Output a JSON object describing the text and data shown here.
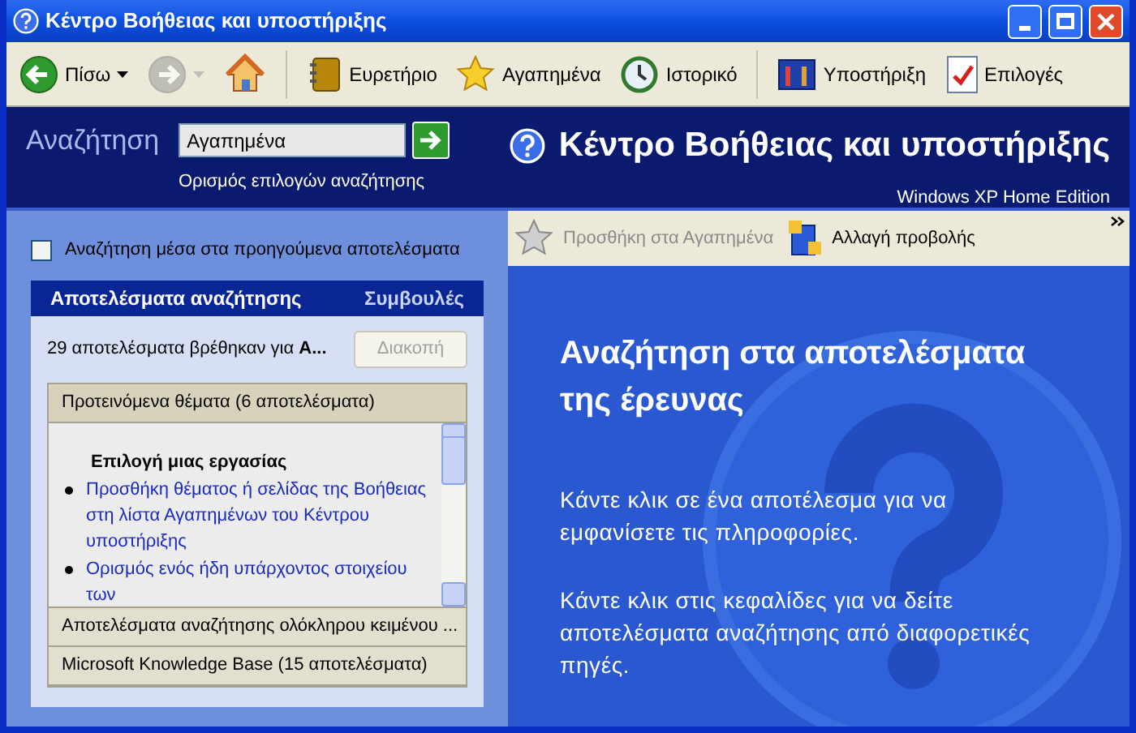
{
  "window": {
    "title": "Κέντρο Βοήθειας και υποστήριξης"
  },
  "toolbar": [
    {
      "kind": "back",
      "label": "Πίσω",
      "disabled": false
    },
    {
      "kind": "forward",
      "disabled": true
    },
    {
      "kind": "home",
      "disabled": false
    },
    {
      "kind": "index",
      "label": "Ευρετήριο",
      "disabled": false
    },
    {
      "kind": "favorites",
      "label": "Αγαπημένα",
      "disabled": false
    },
    {
      "kind": "history",
      "label": "Ιστορικό",
      "disabled": false
    },
    {
      "kind": "support",
      "label": "Υποστήριξη",
      "disabled": false
    },
    {
      "kind": "options",
      "label": "Επιλογές",
      "disabled": false
    }
  ],
  "search": {
    "label": "Αναζήτηση",
    "value": "Αγαπημένα",
    "options_link": "Ορισμός επιλογών αναζήτησης"
  },
  "banner": {
    "title": "Κέντρο Βοήθειας και υποστήριξης",
    "edition": "Windows XP Home Edition"
  },
  "left_panel": {
    "search_within": {
      "label": "Αναζήτηση μέσα στα προηγούμενα αποτελέσματα",
      "checked": false
    },
    "tabs": [
      {
        "label": "Αποτελέσματα αναζήτησης",
        "selected": true
      },
      {
        "label": "Συμβουλές",
        "selected": false
      }
    ],
    "summary": "29 αποτελέσματα βρέθηκαν για **Α...**",
    "stop_button": {
      "label": "Διακοπή",
      "disabled": true
    },
    "sections": [
      {
        "title": "Προτεινόμενα θέματα (6 αποτελέσματα)",
        "expanded": true,
        "group_heading": "Επιλογή μιας εργασίας",
        "items": [
          "Προσθήκη θέματος ή σελίδας της Βοήθειας στη λίστα Αγαπημένων του Κέντρου υποστήριξης",
          "Ορισμός ενός ήδη υπάρχοντος στοιχείου των"
        ]
      },
      {
        "title": "Αποτελέσματα αναζήτησης ολόκληρου κειμένου ...",
        "expanded": false
      },
      {
        "title": "Microsoft Knowledge Base (15 αποτελέσματα)",
        "expanded": false
      }
    ]
  },
  "content_toolbar": [
    {
      "kind": "add-favorite",
      "label": "Προσθήκη στα Αγαπημένα",
      "disabled": true
    },
    {
      "kind": "change-view",
      "label": "Αλλαγή προβολής",
      "disabled": false
    }
  ],
  "content": {
    "heading": "Αναζήτηση στα αποτελέσματα της έρευνας",
    "paragraphs": [
      "Κάντε κλικ σε ένα αποτέλεσμα για να εμφανίσετε τις πληροφορίες.",
      "Κάντε κλικ στις κεφαλίδες για να δείτε αποτελέσματα αναζήτησης από διαφορετικές πηγές."
    ]
  }
}
